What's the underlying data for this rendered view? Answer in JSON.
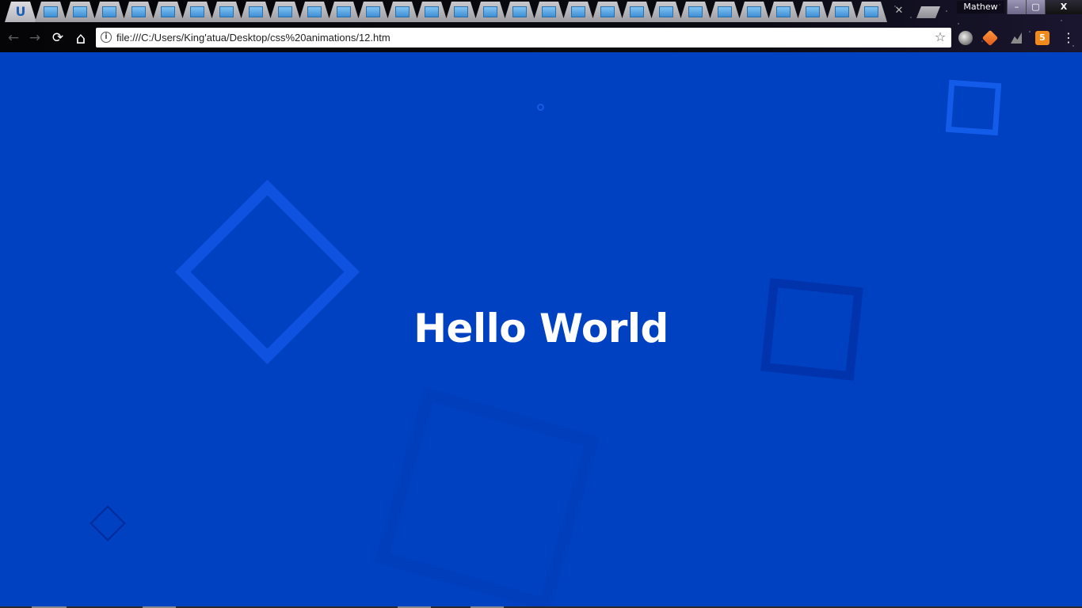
{
  "browser": {
    "tab_count": 31,
    "first_tab_icon": "U",
    "profile_name": "Mathew",
    "window_controls": {
      "minimize": "–",
      "maximize": "▢",
      "close": "X"
    },
    "tab_close_glyph": "✕",
    "nav": {
      "back": "←",
      "forward": "→",
      "reload": "⟳",
      "home": "⌂"
    },
    "url": "file:///C:/Users/King'atua/Desktop/css%20animations/12.htm",
    "info_icon": "i",
    "star_icon": "☆",
    "menu_icon": "⋮",
    "extension_label": "5",
    "icons": [
      "info-icon",
      "star-icon",
      "back-arrow-icon",
      "forward-arrow-icon",
      "reload-icon",
      "home-icon",
      "menu-icon"
    ]
  },
  "page": {
    "headline": "Hello World",
    "colors": {
      "background": "#0041c2",
      "headline": "#ffffff",
      "shape_light": "#165aeb",
      "shape_dark": "#002da0"
    }
  }
}
